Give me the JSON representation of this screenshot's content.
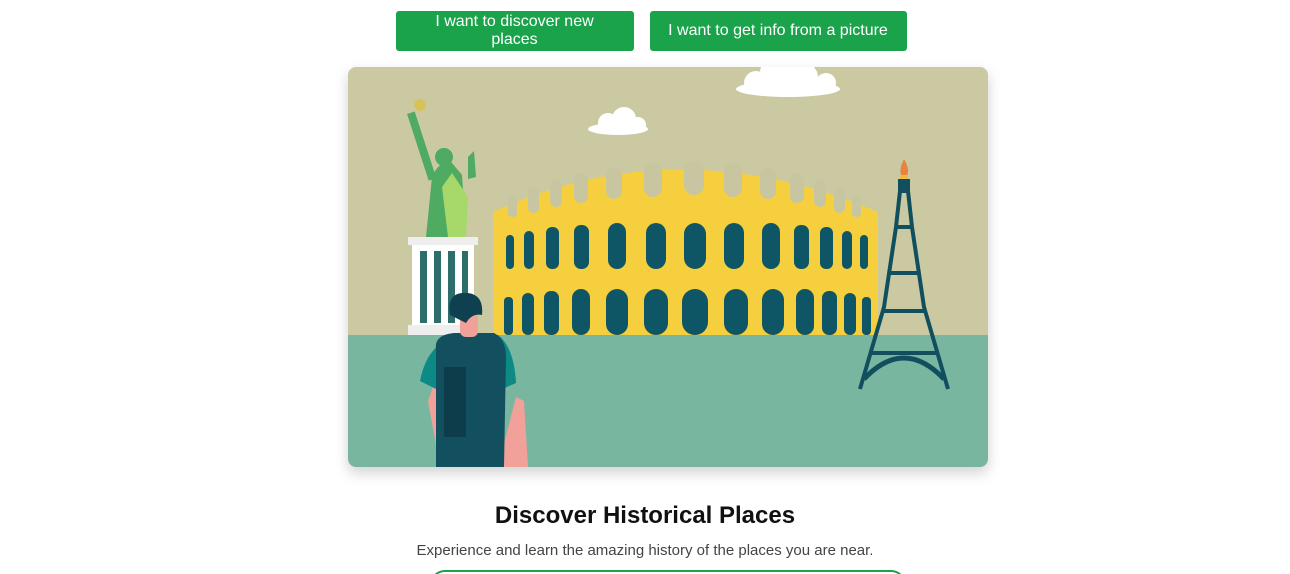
{
  "theme": {
    "accent": "#1aa34a"
  },
  "top_buttons": {
    "discover_label": "I want to discover new places",
    "picture_label": "I want to get info from a picture"
  },
  "hero": {
    "image_subject": "illustration-traveler-colosseum-statue-of-liberty-eiffel-tower"
  },
  "content": {
    "title": "Discover Historical Places",
    "subtitle": "Experience and learn the amazing history of the places you are near."
  }
}
